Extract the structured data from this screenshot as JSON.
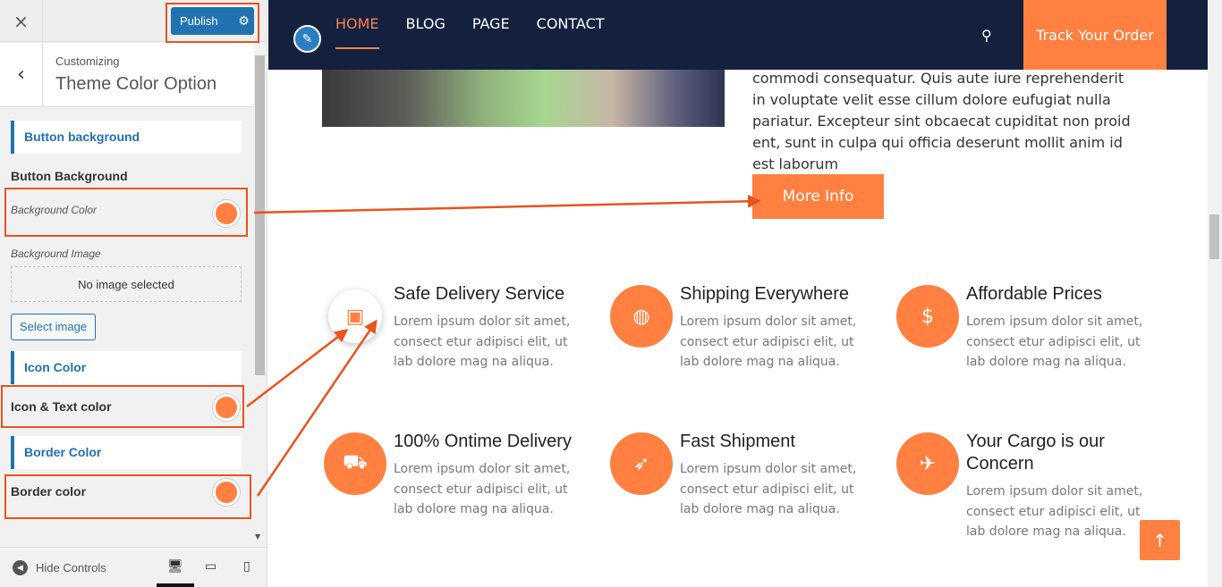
{
  "sidebar": {
    "close_icon": "×",
    "publish_label": "Publish",
    "back_icon": "‹",
    "customizing_label": "Customizing",
    "section_title": "Theme Color Option",
    "button_section_label": "Button background",
    "button_bg_title": "Button Background",
    "bg_color_label": "Background Color",
    "bg_image_label": "Background Image",
    "no_image_text": "No image selected",
    "select_image_label": "Select image",
    "icon_section_label": "Icon Color",
    "icon_text_color_label": "Icon & Text color",
    "border_section_label": "Border Color",
    "border_color_label": "Border color",
    "hide_controls_label": "Hide Controls",
    "swatch_color": "#ff8040"
  },
  "preview": {
    "nav": [
      "HOME",
      "BLOG",
      "PAGE",
      "CONTACT"
    ],
    "track_label": "Track Your Order",
    "hero_text": "commodi consequatur. Quis aute iure reprehenderit in voluptate velit esse cillum dolore eufugiat nulla pariatur. Excepteur sint obcaecat cupiditat non proid ent, sunt in culpa qui officia deserunt mollit anim id est laborum",
    "more_info_label": "More Info",
    "features": [
      {
        "title": "Safe Delivery Service",
        "text": "Lorem ipsum dolor sit amet, consect etur adipisci elit, ut lab dolore mag na aliqua.",
        "icon": "shopping-bag-icon"
      },
      {
        "title": "Shipping Everywhere",
        "text": "Lorem ipsum dolor sit amet, consect etur adipisci elit, ut lab dolore mag na aliqua.",
        "icon": "globe-icon"
      },
      {
        "title": "Affordable Prices",
        "text": "Lorem ipsum dolor sit amet, consect etur adipisci elit, ut lab dolore mag na aliqua.",
        "icon": "dollar-icon"
      },
      {
        "title": "100% Ontime Delivery",
        "text": "Lorem ipsum dolor sit amet, consect etur adipisci elit, ut lab dolore mag na aliqua.",
        "icon": "car-icon"
      },
      {
        "title": "Fast Shipment",
        "text": "Lorem ipsum dolor sit amet, consect etur adipisci elit, ut lab dolore mag na aliqua.",
        "icon": "shipment-icon"
      },
      {
        "title": "Your Cargo is our Concern",
        "text": "Lorem ipsum dolor sit amet, consect etur adipisci elit, ut lab dolore mag na aliqua.",
        "icon": "plane-icon"
      }
    ],
    "accent_color": "#ff8040",
    "nav_bg": "#13213f"
  },
  "annotation_color": "#e8541e"
}
